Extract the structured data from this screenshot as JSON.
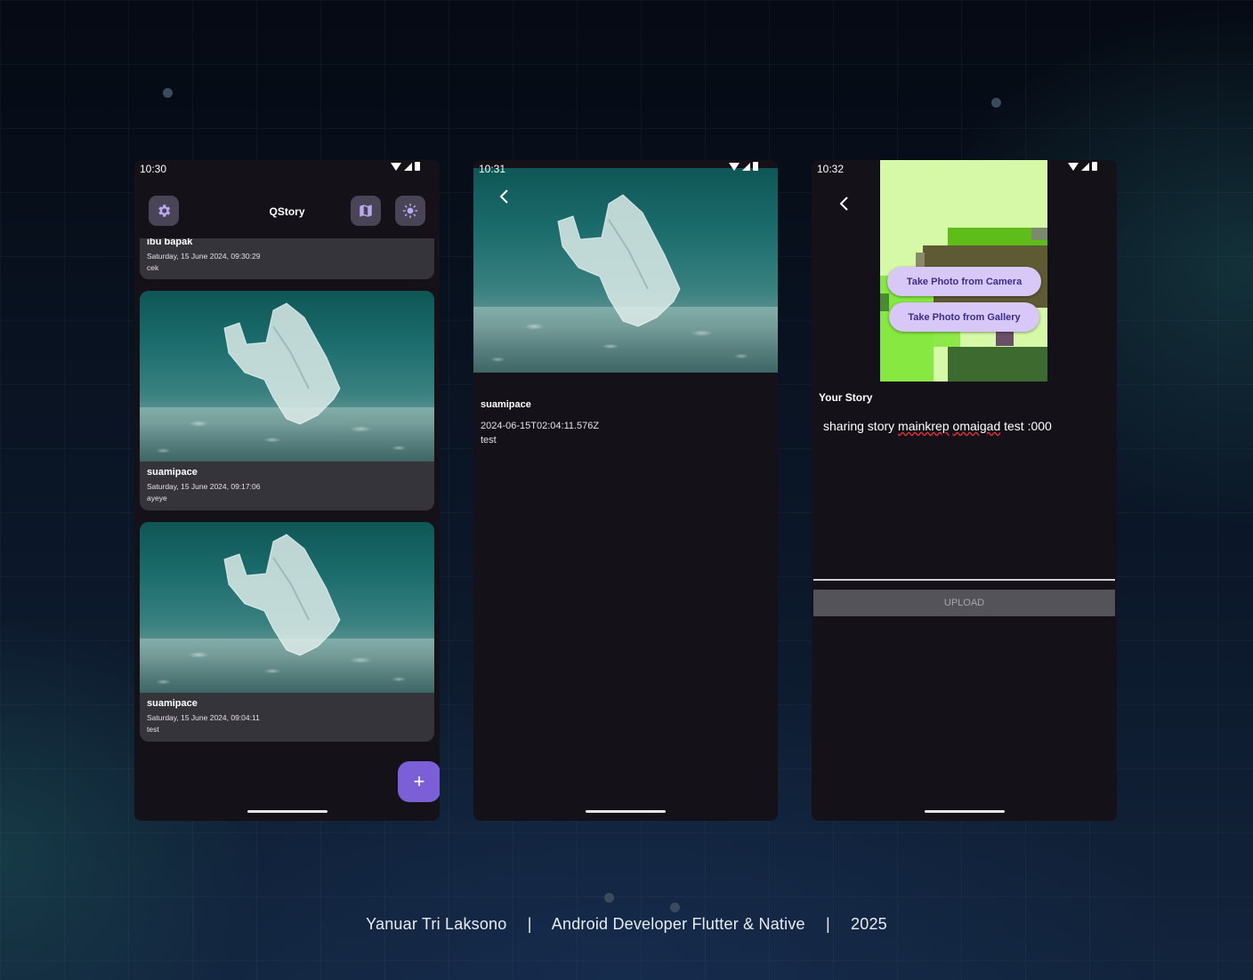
{
  "footer": {
    "author": "Yanuar Tri Laksono",
    "role": "Android Developer Flutter & Native",
    "year": "2025",
    "separator": "|"
  },
  "screen_list": {
    "status_time": "10:30",
    "title": "QStory",
    "icons": [
      "settings-icon",
      "map-icon",
      "theme-toggle-icon"
    ],
    "stories": [
      {
        "name": "ibu bapak",
        "date": "Saturday, 15 June 2024, 09:30:29",
        "description": "cek"
      },
      {
        "name": "suamipace",
        "date": "Saturday, 15 June 2024, 09:17:06",
        "description": "ayeye"
      },
      {
        "name": "suamipace",
        "date": "Saturday, 15 June 2024, 09:04:11",
        "description": "test"
      }
    ],
    "fab_label": "+"
  },
  "screen_detail": {
    "status_time": "10:31",
    "name": "suamipace",
    "created_at": "2024-06-15T02:04:11.576Z",
    "description": "test"
  },
  "screen_add": {
    "status_time": "10:32",
    "camera_label": "Take Photo from Camera",
    "gallery_label": "Take Photo from Gallery",
    "story_label": "Your Story",
    "story_text_parts": [
      "sharing story ",
      "mainkrep",
      " ",
      "omaigad",
      " test :000"
    ],
    "upload_label": "UPLOAD"
  },
  "colors": {
    "phone_bg": "#141218",
    "card_bg": "#36343b",
    "accent": "#7a5fd6",
    "pill_bg": "#d7c8f7"
  }
}
